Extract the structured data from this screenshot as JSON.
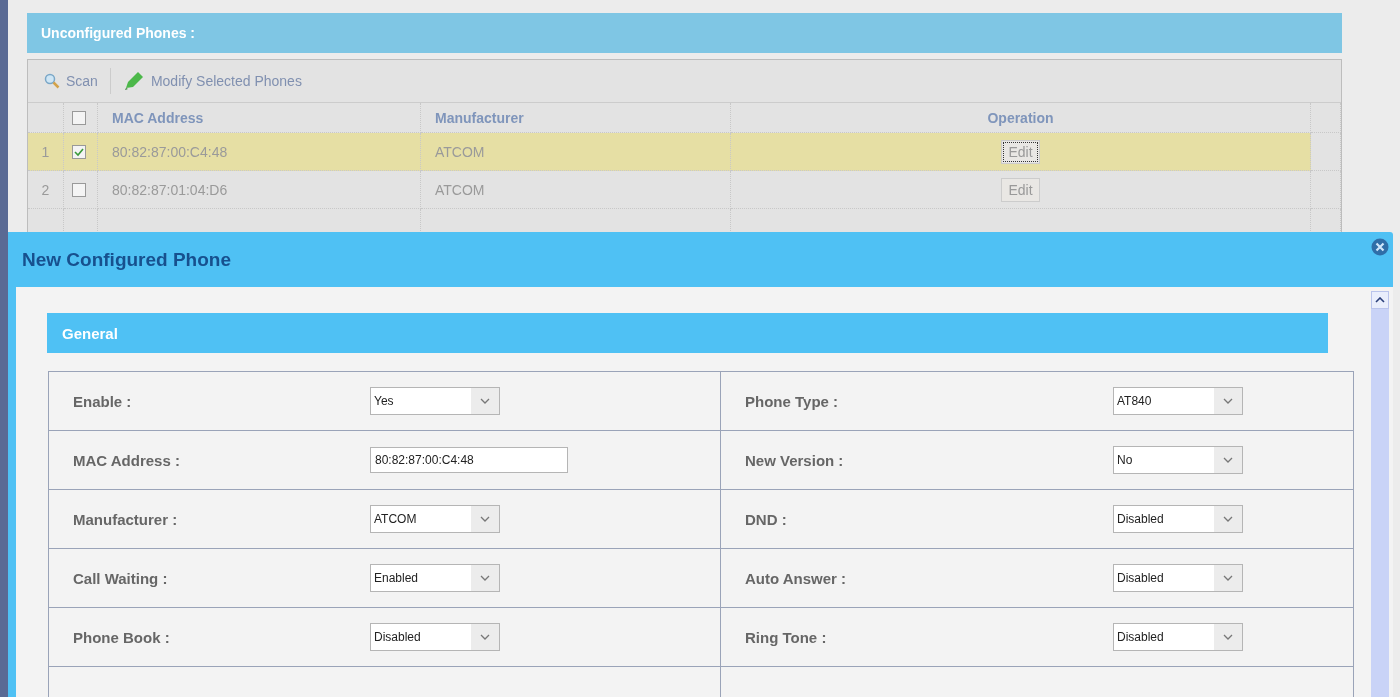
{
  "unconfigured": {
    "title": "Unconfigured Phones :",
    "toolbar": [
      {
        "kind": "scan",
        "label": "Scan"
      },
      {
        "kind": "modify",
        "label": "Modify Selected Phones"
      }
    ],
    "columns": [
      "MAC Address",
      "Manufacturer",
      "Operation"
    ],
    "header_checked": false,
    "rows": [
      {
        "number": "1",
        "checked": true,
        "selected": true,
        "mac": "80:82:87:00:C4:48",
        "manufacturer": "ATCOM",
        "operation": "Edit"
      },
      {
        "number": "2",
        "checked": false,
        "selected": false,
        "mac": "80:82:87:01:04:D6",
        "manufacturer": "ATCOM",
        "operation": "Edit"
      }
    ]
  },
  "dialog": {
    "title": "New Configured Phone",
    "section": "General",
    "rows": [
      {
        "left": {
          "label": "Enable :",
          "kind": "select",
          "value": "Yes"
        },
        "right": {
          "label": "Phone Type :",
          "kind": "select",
          "value": "AT840"
        }
      },
      {
        "left": {
          "label": "MAC Address :",
          "kind": "text",
          "value": "80:82:87:00:C4:48"
        },
        "right": {
          "label": "New Version :",
          "kind": "select",
          "value": "No"
        }
      },
      {
        "left": {
          "label": "Manufacturer :",
          "kind": "select",
          "value": "ATCOM"
        },
        "right": {
          "label": "DND :",
          "kind": "select",
          "value": "Disabled"
        }
      },
      {
        "left": {
          "label": "Call Waiting :",
          "kind": "select",
          "value": "Enabled"
        },
        "right": {
          "label": "Auto Answer :",
          "kind": "select",
          "value": "Disabled"
        }
      },
      {
        "left": {
          "label": "Phone Book :",
          "kind": "select",
          "value": "Disabled"
        },
        "right": {
          "label": "Ring Tone :",
          "kind": "select",
          "value": "Disabled"
        }
      }
    ]
  }
}
